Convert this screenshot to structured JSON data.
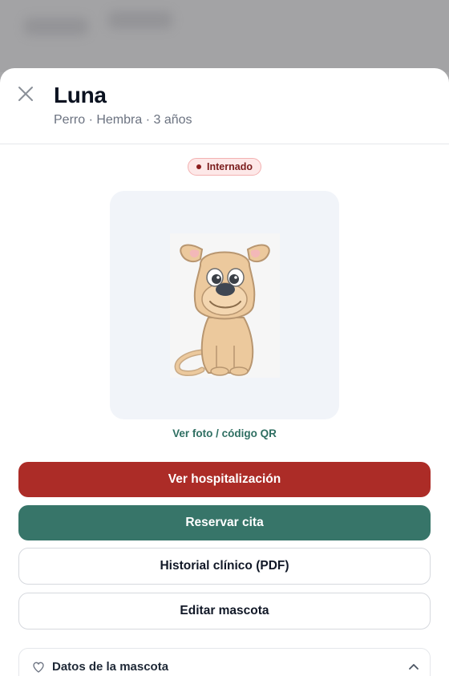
{
  "pet": {
    "name": "Luna",
    "meta": "Perro · Hembra · 3 años",
    "status": "Internado"
  },
  "photo": {
    "link_label": "Ver foto / código QR"
  },
  "actions": {
    "hospitalization_label": "Ver hospitalización",
    "appointment_label": "Reservar cita",
    "history_label": "Historial clínico (PDF)",
    "edit_label": "Editar mascota"
  },
  "sections": {
    "pet_data_title": "Datos de la mascota"
  },
  "colors": {
    "danger": "#ac2c27",
    "primary": "#377569",
    "link": "#2f6f62",
    "badge_bg": "#fde8e8"
  },
  "icons": {
    "close": "close-icon",
    "heart": "heart-icon",
    "chevron": "chevron-up-icon"
  }
}
